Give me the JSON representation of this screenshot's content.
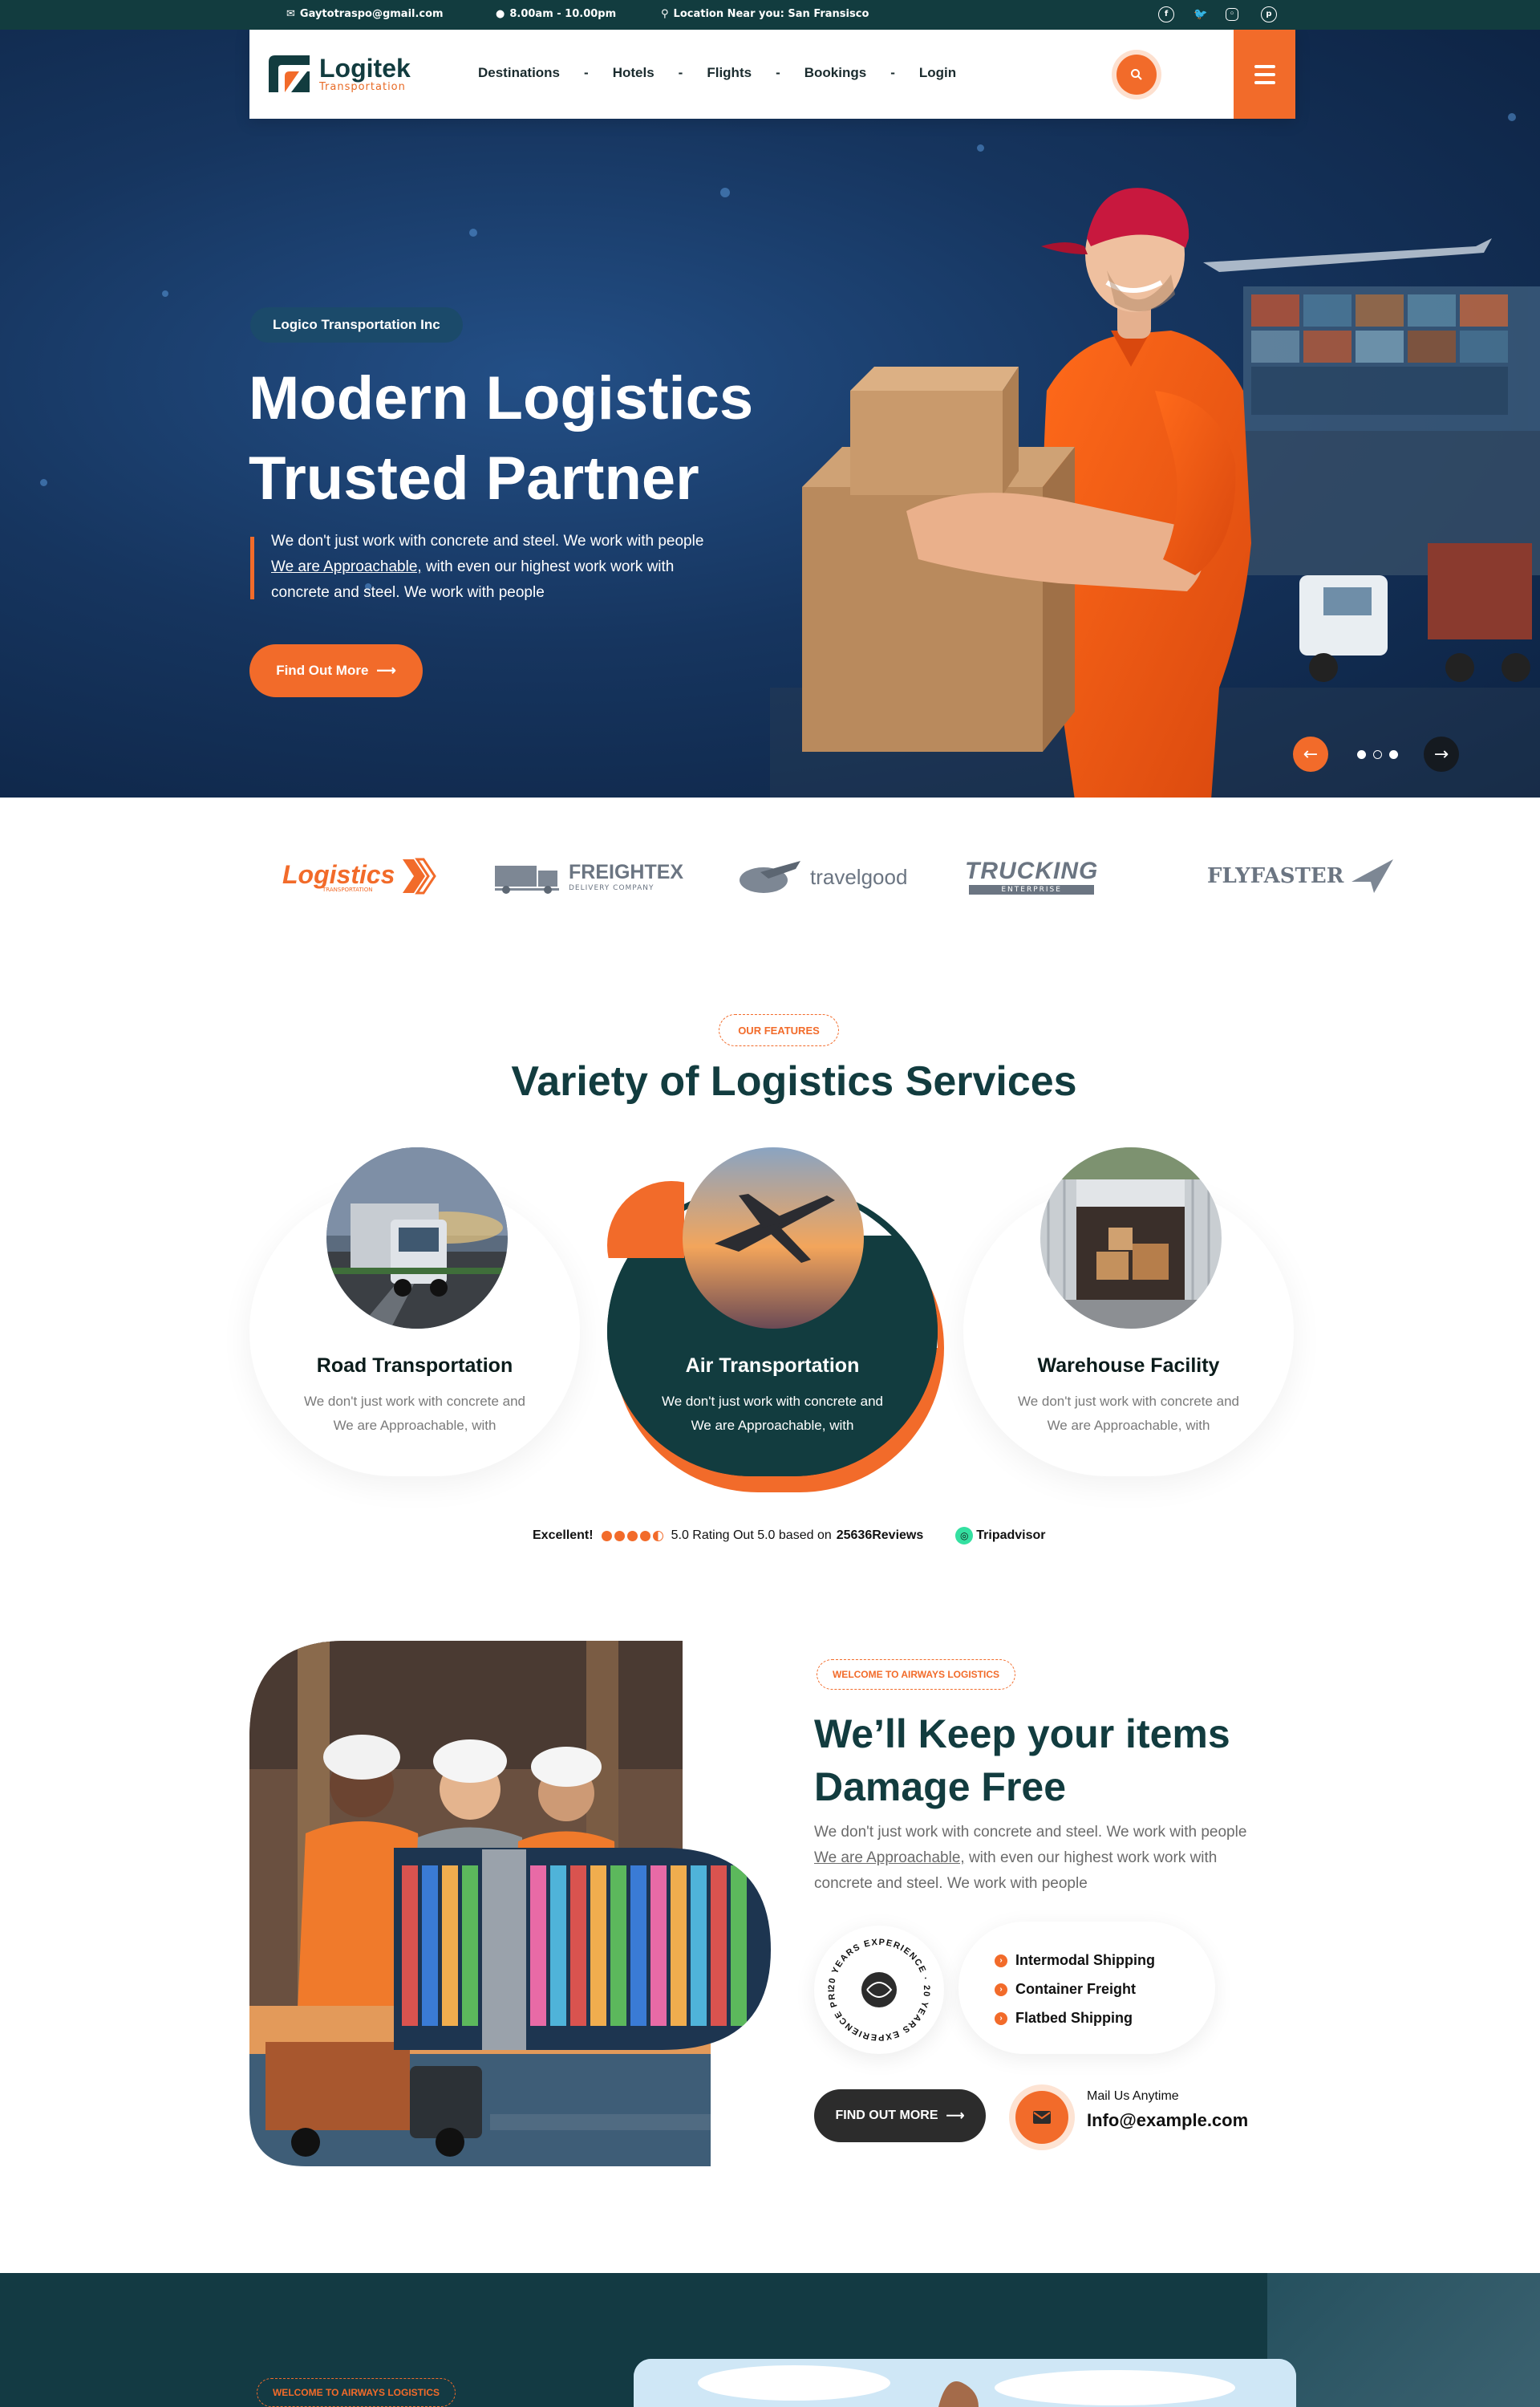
{
  "topbar": {
    "email": "Gaytotraspo@gmail.com",
    "hours": "8.00am - 10.00pm",
    "location": "Location Near you: San Fransisco",
    "socials": [
      "facebook-icon",
      "twitter-icon",
      "instagram-icon",
      "pinterest-icon"
    ]
  },
  "nav": {
    "logo_name": "Logitek",
    "logo_sub": "Transportation",
    "items": [
      "Destinations",
      "Hotels",
      "Flights",
      "Bookings",
      "Login"
    ],
    "separator": "-"
  },
  "hero": {
    "badge": "Logico Transportation Inc",
    "title_line1": "Modern Logistics",
    "title_line2": "Trusted Partner",
    "desc_line1": "We don't just work with concrete and steel. We work  with people",
    "desc_link": "We are Approachable,",
    "desc_line2_rest": " with even  our highest work work with",
    "desc_line3": "concrete and steel. We work  with people",
    "button": "Find Out More",
    "slider_active": 3,
    "slider_count": 3
  },
  "brands": {
    "items": [
      {
        "name": "Logistics",
        "sub": "TRANSPORTATION"
      },
      {
        "name": "FREIGHTEX",
        "sub": "DELIVERY COMPANY"
      },
      {
        "name": "travelgood",
        "sub": ""
      },
      {
        "name": "TRUCKING",
        "sub": "ENTERPRISE"
      },
      {
        "name": "FLYFASTER",
        "sub": ""
      }
    ]
  },
  "features": {
    "label": "OUR FEATURES",
    "title": "Variety of Logistics Services",
    "cards": [
      {
        "title": "Road Transportation",
        "line1": "We don't just work with concrete and",
        "line2": "We are Approachable, with",
        "active": false
      },
      {
        "title": "Air Transportation",
        "line1": "We don't just work with concrete and",
        "line2": "We are Approachable, with",
        "active": true
      },
      {
        "title": "Warehouse Facility",
        "line1": "We don't just work with concrete and",
        "line2": "We are Approachable, with",
        "active": false
      }
    ],
    "rating": {
      "label": "Excellent!",
      "stars": 4.5,
      "text": "5.0 Rating Out 5.0 based on",
      "count": "25636Reviews",
      "brand": "Tripadvisor"
    }
  },
  "about": {
    "label": "WELCOME TO AIRWAYS LOGISTICS",
    "title_line1": "We’ll Keep your items",
    "title_line2": "Damage Free",
    "desc_line1": "We don't just work with concrete and steel. We work  with people",
    "desc_link": "We are Approachable,",
    "desc_line2_rest": " with even  our highest work work with",
    "desc_line3": "concrete and steel. We work  with people",
    "badge_text": "20 YEARS EXPERIENCE · 20 YEARS EXPERIENCE PRICE ·",
    "list": [
      "Intermodal Shipping",
      "Container Freight",
      "Flatbed Shipping"
    ],
    "button": "FIND OUT MORE",
    "mail_label": "Mail Us Anytime",
    "mail_value": "Info@example.com"
  },
  "band": {
    "label": "WELCOME TO AIRWAYS LOGISTICS"
  },
  "colors": {
    "accent": "#f26b2a",
    "dark_teal": "#123c3f",
    "hero_blue": "#16355f"
  }
}
